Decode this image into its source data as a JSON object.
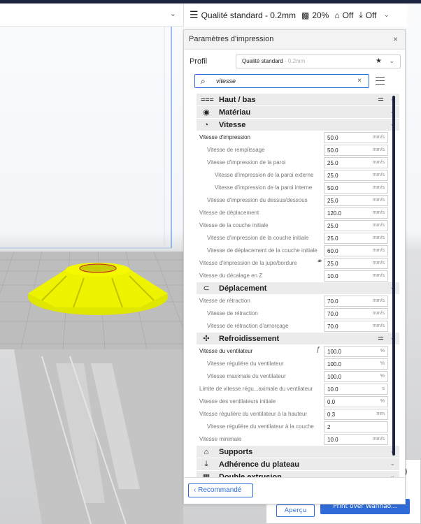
{
  "toolbar": {
    "quality_label": "Qualité standard - 0.2mm",
    "infill_label": "20%",
    "support_label": "Off",
    "adhesion_label": "Off"
  },
  "panel": {
    "title": "Paramètres d'impression",
    "profile_label": "Profil",
    "profile_value": "Qualité standard",
    "profile_suffix": " - 0.2mm",
    "search_value": "vitesse",
    "recommended_label": "Recommandé"
  },
  "categories": [
    {
      "name": "Haut / bas",
      "icon": "top-bottom-icon",
      "glyph": "⩶",
      "settings": true
    },
    {
      "name": "Matériau",
      "icon": "material-icon",
      "glyph": "◉",
      "settings": false
    },
    {
      "name": "Vitesse",
      "icon": "speed-icon",
      "glyph": "◔",
      "settings": false
    },
    {
      "name": "Déplacement",
      "icon": "travel-icon",
      "glyph": "⊂",
      "settings": false
    },
    {
      "name": "Refroidissement",
      "icon": "fan-icon",
      "glyph": "✣",
      "settings": true
    },
    {
      "name": "Supports",
      "icon": "support-icon",
      "glyph": "⌂",
      "settings": false
    },
    {
      "name": "Adhérence du plateau",
      "icon": "adhesion-icon",
      "glyph": "⤓",
      "settings": false
    },
    {
      "name": "Double extrusion",
      "icon": "dual-extrusion-icon",
      "glyph": "▦",
      "settings": false
    }
  ],
  "speed_settings": [
    {
      "label": "Vitesse d'impression",
      "value": "50.0",
      "unit": "mm/s"
    },
    {
      "label": "Vitesse de remplissage",
      "value": "50.0",
      "unit": "mm/s"
    },
    {
      "label": "Vitesse d'impression de la paroi",
      "value": "25.0",
      "unit": "mm/s"
    },
    {
      "label": "Vitesse d'impression de la paroi externe",
      "value": "25.0",
      "unit": "mm/s"
    },
    {
      "label": "Vitesse d'impression de la paroi interne",
      "value": "50.0",
      "unit": "mm/s"
    },
    {
      "label": "Vitesse d'impression du dessus/dessous",
      "value": "25.0",
      "unit": "mm/s"
    },
    {
      "label": "Vitesse de déplacement",
      "value": "120.0",
      "unit": "mm/s"
    },
    {
      "label": "Vitesse de la couche initiale",
      "value": "25.0",
      "unit": "mm/s"
    },
    {
      "label": "Vitesse d'impression de la couche initiale",
      "value": "25.0",
      "unit": "mm/s"
    },
    {
      "label": "Vitesse de déplacement de la couche initiale",
      "value": "60.0",
      "unit": "mm/s"
    },
    {
      "label": "Vitesse d'impression de la jupe/bordure",
      "value": "25.0",
      "unit": "mm/s"
    },
    {
      "label": "Vitesse du décalage en Z",
      "value": "10.0",
      "unit": "mm/s"
    }
  ],
  "travel_settings": [
    {
      "label": "Vitesse de rétraction",
      "value": "70.0",
      "unit": "mm/s"
    },
    {
      "label": "Vitesse de rétraction",
      "value": "70.0",
      "unit": "mm/s"
    },
    {
      "label": "Vitesse de rétraction d'amorçage",
      "value": "70.0",
      "unit": "mm/s"
    }
  ],
  "cooling_settings": [
    {
      "label": "Vitesse du ventilateur",
      "value": "100.0",
      "unit": "%"
    },
    {
      "label": "Vitesse régulière du ventilateur",
      "value": "100.0",
      "unit": "%"
    },
    {
      "label": "Vitesse maximale du ventilateur",
      "value": "100.0",
      "unit": "%"
    },
    {
      "label": "Limite de vitesse régu...aximale du ventilateur",
      "value": "10.0",
      "unit": "s"
    },
    {
      "label": "Vitesse des ventilateurs initiale",
      "value": "0.0",
      "unit": "%"
    },
    {
      "label": "Vitesse régulière du ventilateur à la hauteur",
      "value": "0.3",
      "unit": "mm"
    },
    {
      "label": "Vitesse régulière du ventilateur à la couche",
      "value": "2",
      "unit": ""
    },
    {
      "label": "Vitesse minimale",
      "value": "10.0",
      "unit": "mm/s"
    }
  ],
  "background": {
    "preview_label": "Aperçu",
    "print_label": "Print over Wanhao..."
  },
  "colors": {
    "accent": "#2f6bd8",
    "model": "#e8f000",
    "scrollbar": "#1c2340"
  }
}
